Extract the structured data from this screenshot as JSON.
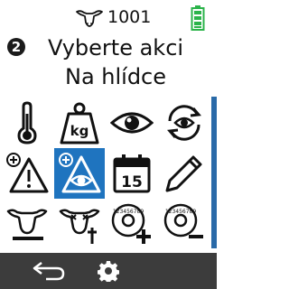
{
  "status_bar": {
    "animal_icon": "cow-head-icon",
    "animal_number": "1001",
    "battery_icon": "battery-full-icon",
    "battery_color": "#2bb34a"
  },
  "header": {
    "step_number": "2",
    "title": "Vyberte akci",
    "subtitle": "Na hlídce"
  },
  "actions": [
    {
      "icon": "thermometer-icon"
    },
    {
      "icon": "weight-kg-icon",
      "label": "kg"
    },
    {
      "icon": "eye-icon"
    },
    {
      "icon": "eye-repeat-icon"
    },
    {
      "icon": "add-warning-icon"
    },
    {
      "icon": "add-watch-selected-icon",
      "selected": true
    },
    {
      "icon": "calendar-icon",
      "label": "15"
    },
    {
      "icon": "pencil-icon"
    },
    {
      "icon": "cow-remove-icon"
    },
    {
      "icon": "cow-dead-icon"
    },
    {
      "icon": "ear-tag-add-icon",
      "label": "123456789"
    },
    {
      "icon": "ear-tag-remove-icon",
      "label": "123456789"
    }
  ],
  "bottom_bar": {
    "back_icon": "back-arrow-icon",
    "settings_icon": "gear-icon"
  },
  "colors": {
    "selected": "#1f74bf",
    "scrollbar": "#2a6aa8",
    "bottom_bar": "#3c3c3c"
  }
}
